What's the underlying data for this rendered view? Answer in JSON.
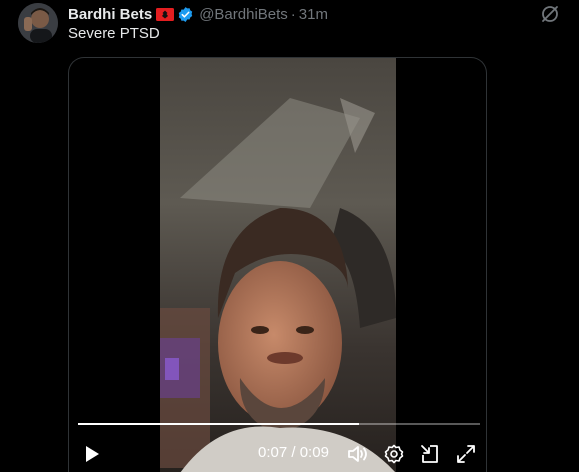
{
  "author": {
    "name": "Bardhi Bets",
    "handle": "@BardhiBets",
    "separator": "·",
    "time": "31m",
    "flag_icon": "albania-flag-icon",
    "verified_icon": "verified-badge-icon",
    "verified_color": "#1d9bf0"
  },
  "tweet": {
    "text": "Severe PTSD"
  },
  "video": {
    "current_time": "0:07",
    "time_separator": "/",
    "duration": "0:09",
    "progress_fraction": 0.7,
    "controls": [
      "play-icon",
      "volume-icon",
      "settings-icon",
      "pip-icon",
      "fullscreen-icon"
    ]
  },
  "colors": {
    "background": "#000000",
    "text_primary": "#e7e9ea",
    "text_secondary": "#71767b",
    "flag_red": "#e41e20"
  }
}
